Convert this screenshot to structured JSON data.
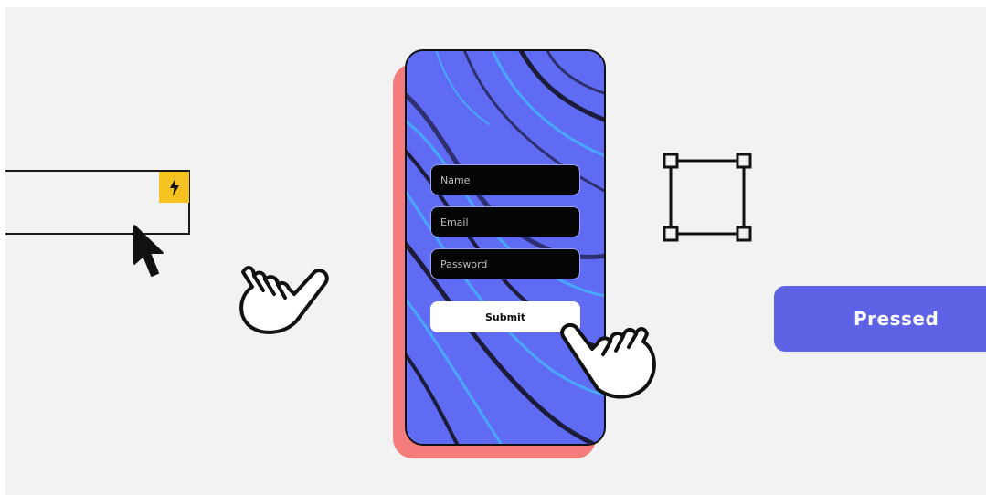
{
  "form": {
    "name_placeholder": "Name",
    "email_placeholder": "Email",
    "password_placeholder": "Password",
    "submit_label": "Submit"
  },
  "pressed_button": {
    "label": "Pressed"
  },
  "icons": [
    "lightning-icon",
    "cursor-arrow-icon",
    "pointing-hand-icon",
    "selection-handles-icon"
  ],
  "colors": {
    "accent": "#5e63e6",
    "phone_background": "#5e6bf2",
    "phone_shadow": "#f47c7c",
    "badge": "#f6c221",
    "canvas": "#f2f2f2"
  }
}
